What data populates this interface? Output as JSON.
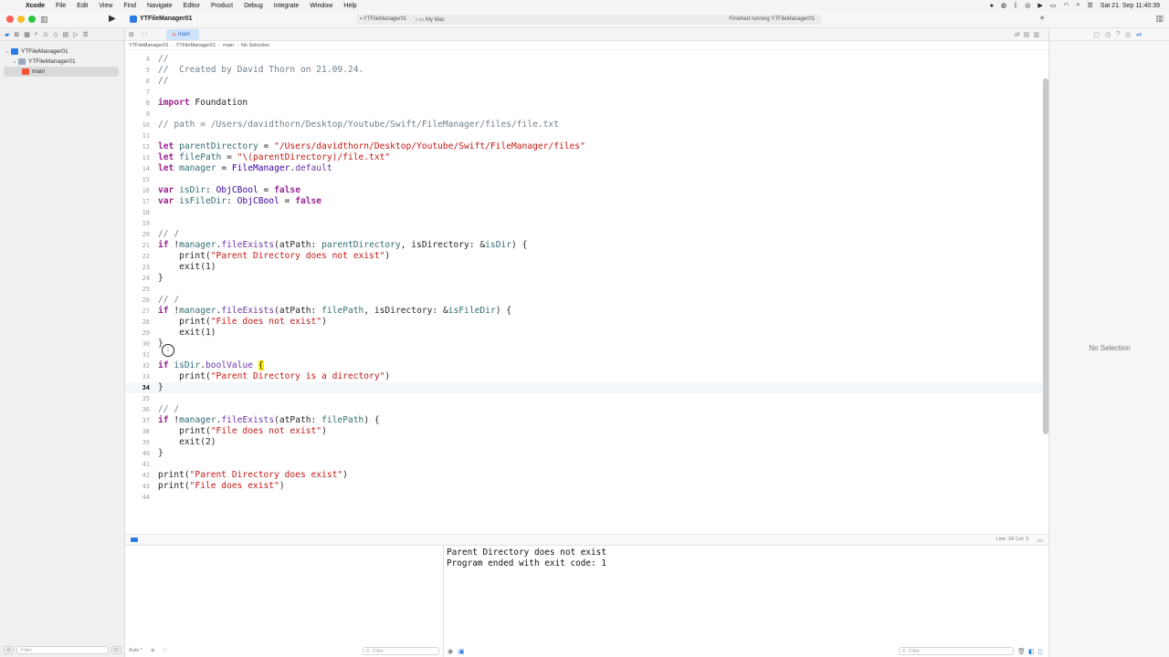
{
  "menubar": {
    "app": "Xcode",
    "items": [
      "File",
      "Edit",
      "View",
      "Find",
      "Navigate",
      "Editor",
      "Product",
      "Debug",
      "Integrate",
      "Window",
      "Help"
    ],
    "datetime": "Sat 21. Sep  11:40:39"
  },
  "toolbar": {
    "project_title": "YTFileManager01",
    "scheme_target": "YTFileManager01",
    "scheme_dest": "My Mac",
    "status": "Finished running YTFileManager01"
  },
  "navigator": {
    "tree": [
      {
        "label": "YTFileManager01",
        "kind": "project"
      },
      {
        "label": "YTFileManager01",
        "kind": "folder"
      },
      {
        "label": "main",
        "kind": "swift"
      }
    ],
    "filter_placeholder": "Filter"
  },
  "editor": {
    "tab": "main",
    "jumpbar": [
      "YTFileManager01",
      "YTFileManager01",
      "main",
      "No Selection"
    ],
    "status_position": "Line: 34  Col: 3"
  },
  "code": [
    {
      "n": "4",
      "t": "//"
    },
    {
      "n": "5",
      "t": "//  Created by David Thorn on 21.09.24."
    },
    {
      "n": "6",
      "t": "//"
    },
    {
      "n": "7",
      "t": ""
    },
    {
      "n": "8",
      "t": "import Foundation"
    },
    {
      "n": "9",
      "t": ""
    },
    {
      "n": "10",
      "t": "// path = /Users/davidthorn/Desktop/Youtube/Swift/FileManager/files/file.txt"
    },
    {
      "n": "11",
      "t": ""
    },
    {
      "n": "12",
      "t": "let parentDirectory = \"/Users/davidthorn/Desktop/Youtube/Swift/FileManager/files\""
    },
    {
      "n": "13",
      "t": "let filePath = \"\\(parentDirectory)/file.txt\""
    },
    {
      "n": "14",
      "t": "let manager = FileManager.default"
    },
    {
      "n": "15",
      "t": ""
    },
    {
      "n": "16",
      "t": "var isDir: ObjCBool = false"
    },
    {
      "n": "17",
      "t": "var isFileDir: ObjCBool = false"
    },
    {
      "n": "18",
      "t": ""
    },
    {
      "n": "19",
      "t": ""
    },
    {
      "n": "20",
      "t": "// /"
    },
    {
      "n": "21",
      "t": "if !manager.fileExists(atPath: parentDirectory, isDirectory: &isDir) {"
    },
    {
      "n": "22",
      "t": "    print(\"Parent Directory does not exist\")"
    },
    {
      "n": "23",
      "t": "    exit(1)"
    },
    {
      "n": "24",
      "t": "}"
    },
    {
      "n": "25",
      "t": ""
    },
    {
      "n": "26",
      "t": "// /"
    },
    {
      "n": "27",
      "t": "if !manager.fileExists(atPath: filePath, isDirectory: &isFileDir) {"
    },
    {
      "n": "28",
      "t": "    print(\"File does not exist\")"
    },
    {
      "n": "29",
      "t": "    exit(1)"
    },
    {
      "n": "30",
      "t": "}"
    },
    {
      "n": "31",
      "t": ""
    },
    {
      "n": "32",
      "t": "if isDir.boolValue {"
    },
    {
      "n": "33",
      "t": "    print(\"Parent Directory is a directory\")"
    },
    {
      "n": "34",
      "t": "}"
    },
    {
      "n": "35",
      "t": ""
    },
    {
      "n": "36",
      "t": "// /"
    },
    {
      "n": "37",
      "t": "if !manager.fileExists(atPath: filePath) {"
    },
    {
      "n": "38",
      "t": "    print(\"File does not exist\")"
    },
    {
      "n": "39",
      "t": "    exit(2)"
    },
    {
      "n": "40",
      "t": "}"
    },
    {
      "n": "41",
      "t": ""
    },
    {
      "n": "42",
      "t": "print(\"Parent Directory does exist\")"
    },
    {
      "n": "43",
      "t": "print(\"File does exist\")"
    },
    {
      "n": "44",
      "t": ""
    }
  ],
  "current_line": "34",
  "console": {
    "lines": [
      "Parent Directory does not exist",
      "Program ended with exit code: 1"
    ],
    "variables_scope": "Auto",
    "filter_placeholder": "Filter"
  },
  "inspector": {
    "empty_text": "No Selection"
  },
  "colors": {
    "keyword": "#9b2393",
    "string": "#c41a16",
    "comment": "#707f8c",
    "type": "#3900a0",
    "accent": "#2c7be5"
  }
}
